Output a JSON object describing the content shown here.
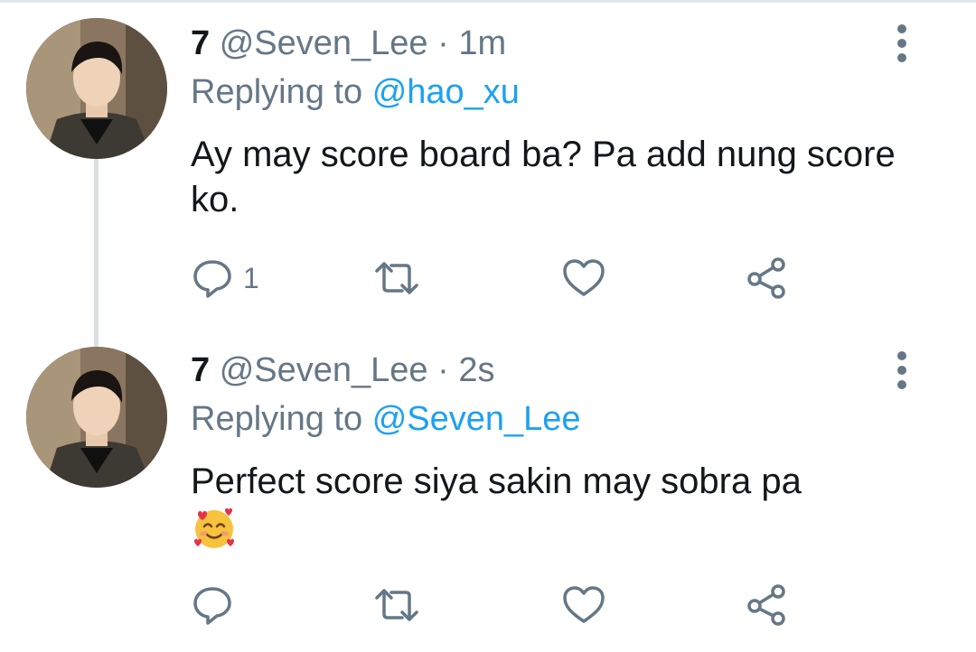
{
  "tweets": [
    {
      "display_name": "7",
      "handle": "@Seven_Lee",
      "separator": "·",
      "time": "1m",
      "replying_to_label": "Replying to",
      "replying_to_handle": "@hao_xu",
      "text": "Ay may score board ba? Pa add nung score ko.",
      "emoji": "",
      "reply_count": "1",
      "avatar_icon": "profile-photo"
    },
    {
      "display_name": "7",
      "handle": "@Seven_Lee",
      "separator": "·",
      "time": "2s",
      "replying_to_label": "Replying to",
      "replying_to_handle": "@Seven_Lee",
      "text": "Perfect score siya sakin may sobra pa",
      "emoji": "smiling-face-with-hearts",
      "reply_count": "",
      "avatar_icon": "profile-photo"
    }
  ],
  "icons": {
    "reply": "reply-icon",
    "retweet": "retweet-icon",
    "like": "heart-icon",
    "share": "share-icon",
    "more": "more-vertical-icon"
  },
  "colors": {
    "text": "#14171a",
    "secondary": "#657786",
    "link": "#1da1f2",
    "thread_line": "#dcdfe2"
  }
}
